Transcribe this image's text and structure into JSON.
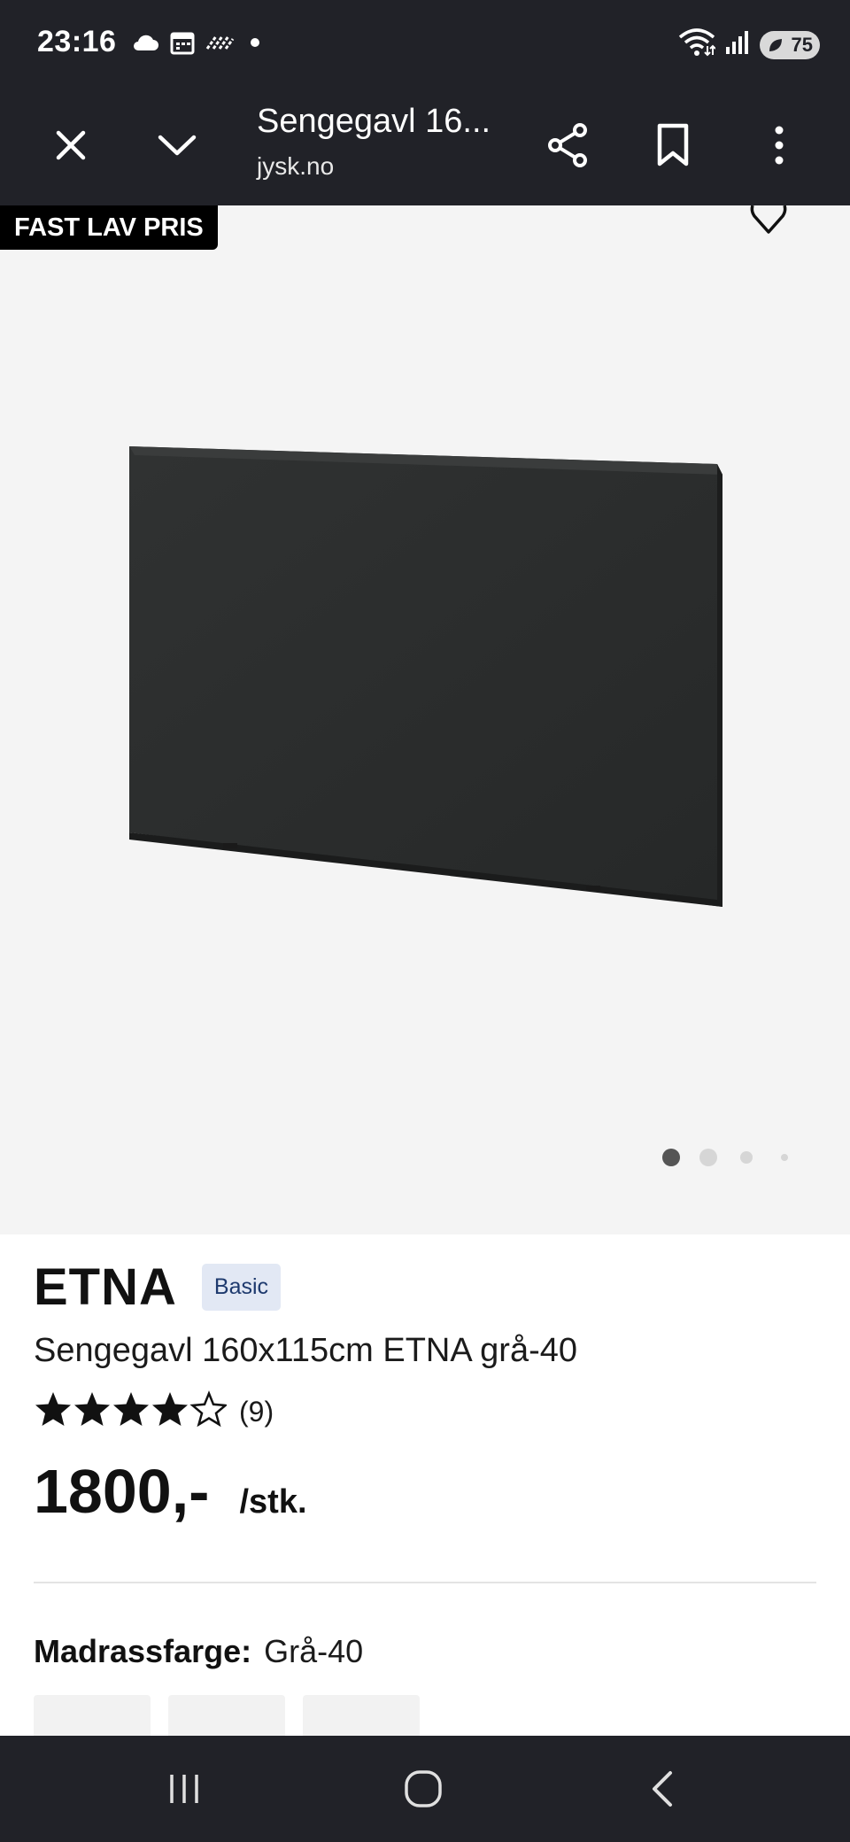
{
  "status_bar": {
    "time": "23:16",
    "battery": "75",
    "left_icons": [
      "cloud-icon",
      "calendar-icon",
      "nfc-icon",
      "dot-icon"
    ],
    "right_icons": [
      "wifi-icon",
      "signal-icon",
      "battery-icon"
    ]
  },
  "browser": {
    "title": "Sengegavl 16...",
    "domain": "jysk.no",
    "icons": [
      "close-icon",
      "chevron-down-icon",
      "share-icon",
      "bookmark-icon",
      "more-vert-icon"
    ]
  },
  "hero": {
    "badge": "FAST LAV PRIS",
    "favorite_icon": "heart-icon",
    "image_pages": 4,
    "active_page": 1,
    "background": "#f4f4f4"
  },
  "product": {
    "brand": "ETNA",
    "tag": "Basic",
    "name": "Sengegavl 160x115cm ETNA grå-40",
    "rating": 4,
    "rating_max": 5,
    "rating_count": "(9)",
    "price": "1800,-",
    "unit": "/stk.",
    "color_label": "Madrassfarge:",
    "color_value": "Grå-40"
  },
  "colors": {
    "bars": "#212228",
    "tag_bg": "#e2e8f4",
    "tag_text": "#1e3a6e"
  },
  "nav": {
    "icons": [
      "recent-apps-icon",
      "home-icon",
      "back-icon"
    ]
  }
}
